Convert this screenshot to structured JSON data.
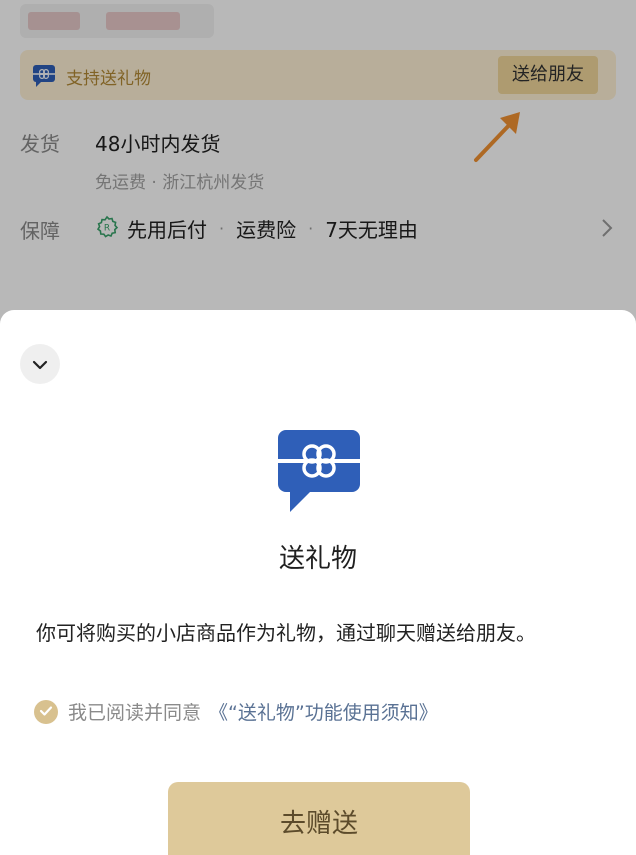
{
  "product_panel": {
    "gift_support_label": "支持送礼物",
    "send_to_friend_button": "送给朋友",
    "shipping": {
      "label": "发货",
      "main": "48小时内发货",
      "sub": "免运费 · 浙江杭州发货"
    },
    "guarantee": {
      "label": "保障",
      "items": [
        "先用后付",
        "运费险",
        "7天无理由"
      ]
    }
  },
  "sheet": {
    "title": "送礼物",
    "description": "你可将购买的小店商品作为礼物，通过聊天赠送给朋友。",
    "agree_text": "我已阅读并同意",
    "agree_link": "《“送礼物”功能使用须知》",
    "cta_button": "去赠送"
  },
  "colors": {
    "accent_gold": "#dec99a",
    "brand_blue": "#2f5fb8",
    "link_blue": "#5a7294",
    "arrow_orange": "#f29233"
  },
  "icons": {
    "gift": "gift-chat-icon",
    "collapse": "chevron-down-icon",
    "more": "chevron-right-icon",
    "guarantee": "shield-badge-icon",
    "check": "check-icon"
  }
}
